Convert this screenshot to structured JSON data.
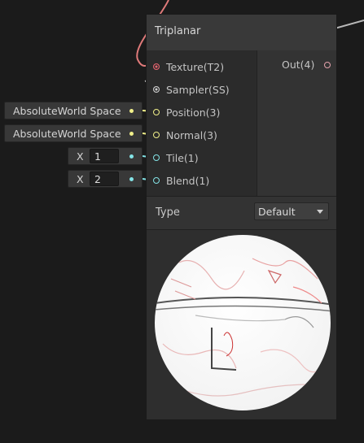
{
  "node": {
    "title": "Triplanar",
    "inputs": [
      {
        "label": "Texture(T2)",
        "color": "#e4646f"
      },
      {
        "label": "Sampler(SS)",
        "color": "#cfcfcf"
      },
      {
        "label": "Position(3)",
        "color": "#f1f08a"
      },
      {
        "label": "Normal(3)",
        "color": "#f1f08a"
      },
      {
        "label": "Tile(1)",
        "color": "#84e4e7"
      },
      {
        "label": "Blend(1)",
        "color": "#84e4e7"
      }
    ],
    "output": {
      "label": "Out(4)",
      "color": "#e5a3ad"
    },
    "type_label": "Type",
    "type_value": "Default"
  },
  "external_fields": {
    "position_space": "AbsoluteWorld Space",
    "normal_space": "AbsoluteWorld Space",
    "tile_axis": "X",
    "tile_value": "1",
    "blend_axis": "X",
    "blend_value": "2"
  },
  "colors": {
    "background": "#1b1b1b",
    "texture_wire": "#e07a7a",
    "sampler_wire": "#b0b0b0"
  }
}
